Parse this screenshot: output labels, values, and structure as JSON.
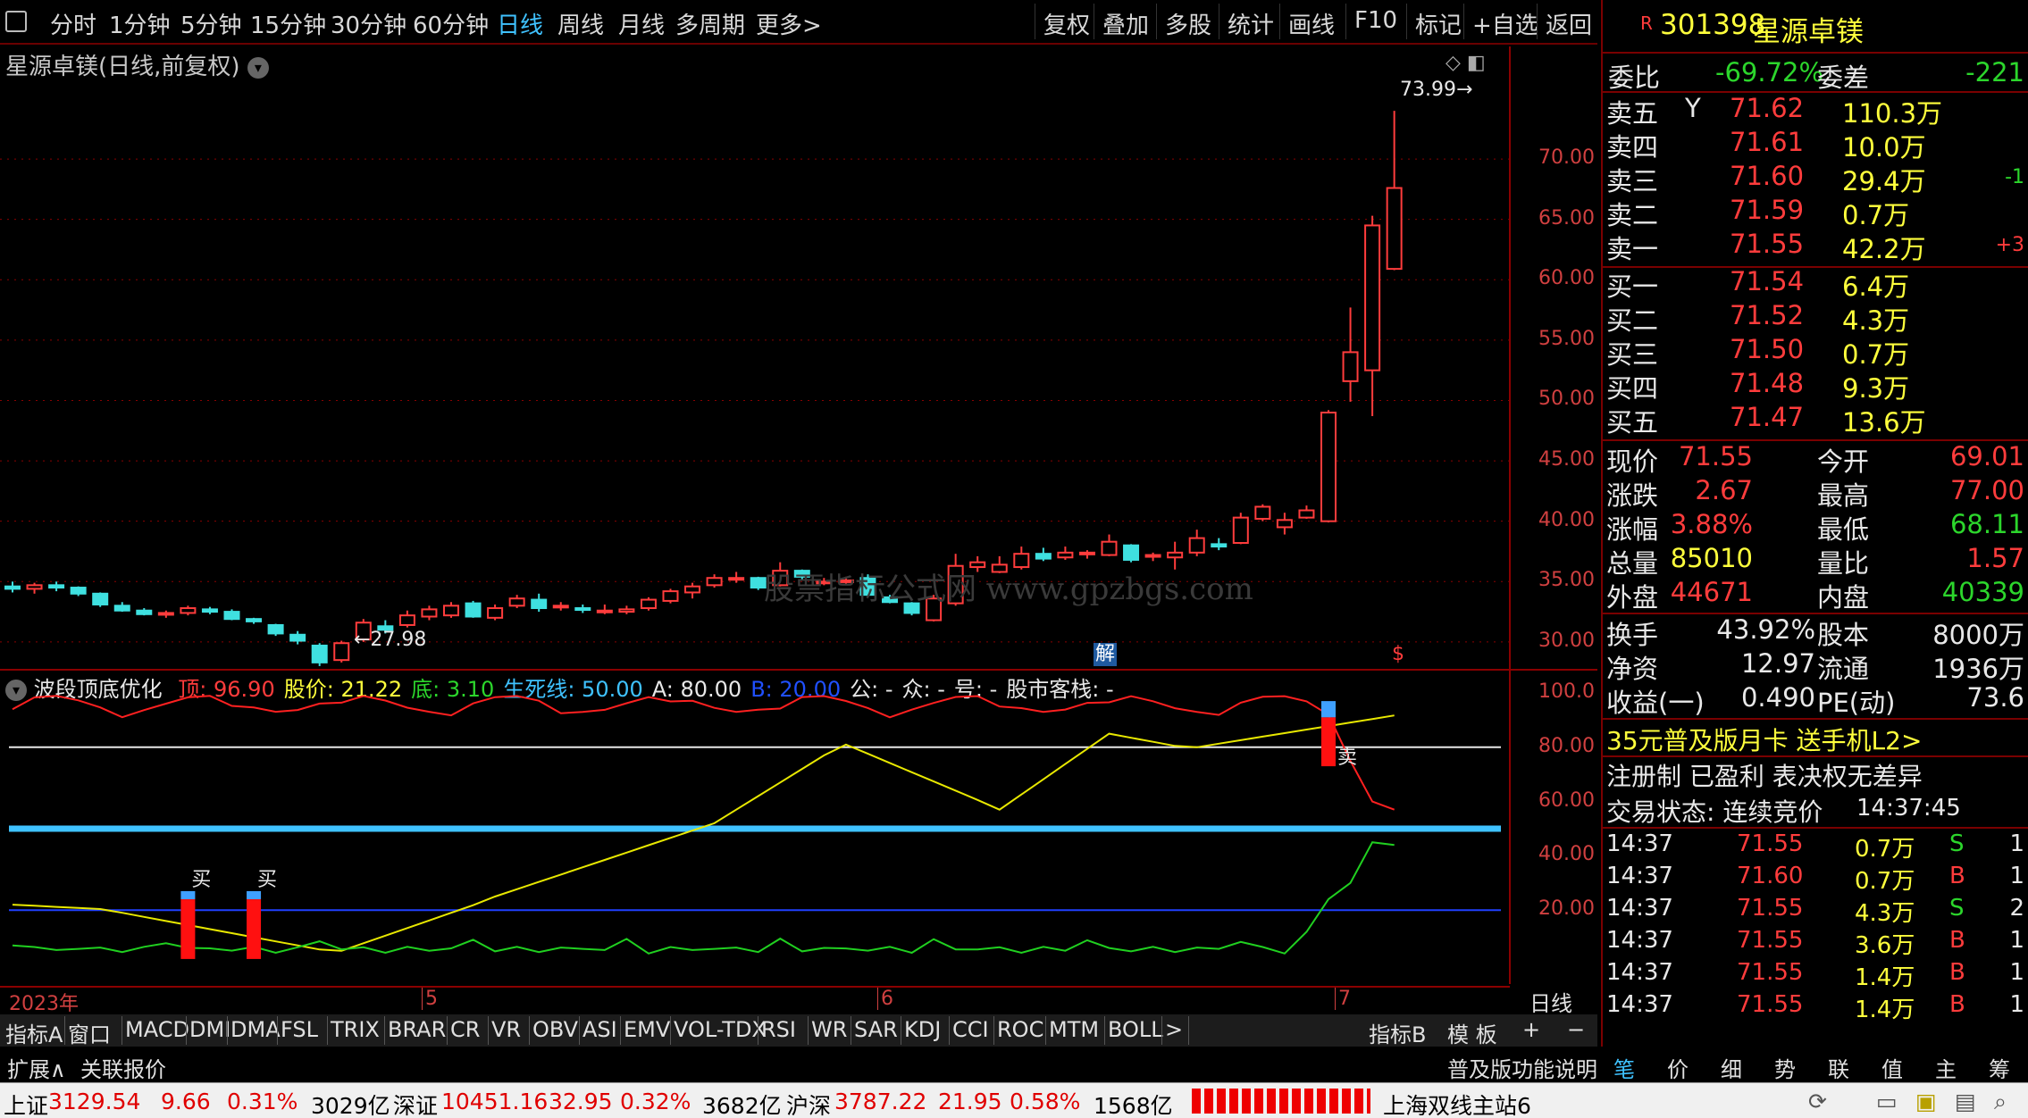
{
  "colors": {
    "up": "#ff3c3c",
    "down": "#3fe0e0",
    "bg": "#000000",
    "grid": "#8b0000",
    "accent": "#3fc2ff",
    "yellow": "#ffff3c",
    "green": "#2cd62c"
  },
  "toolbar": {
    "periods": [
      "分时",
      "1分钟",
      "5分钟",
      "15分钟",
      "30分钟",
      "60分钟",
      "日线",
      "周线",
      "月线",
      "多周期",
      "更多>"
    ],
    "active": "日线",
    "tools": [
      "复权",
      "叠加",
      "多股",
      "统计",
      "画线",
      "F10",
      "标记",
      "+自选",
      "返回"
    ]
  },
  "chart": {
    "title": "星源卓镁(日线,前复权)",
    "high_label": "73.99",
    "low_label": "←27.98",
    "y_ticks": [
      "70.00",
      "65.00",
      "60.00",
      "55.00",
      "50.00",
      "45.00",
      "40.00",
      "35.00",
      "30.00"
    ],
    "watermark": "股票指标公式网 www.gpzbgs.com",
    "marker_jie": "解",
    "marker_s": "$",
    "x_labels": [
      "2023年",
      "5",
      "6",
      "7"
    ],
    "period_label": "日线"
  },
  "chart_data": {
    "type": "candlestick",
    "y_range": [
      27,
      76
    ],
    "candles": [
      [
        34.6,
        35.0,
        34.1,
        34.4
      ],
      [
        34.4,
        34.9,
        34.0,
        34.7
      ],
      [
        34.7,
        35.0,
        34.2,
        34.5
      ],
      [
        34.5,
        34.6,
        33.8,
        34.0
      ],
      [
        34.0,
        34.1,
        32.9,
        33.1
      ],
      [
        33.0,
        33.3,
        32.5,
        32.6
      ],
      [
        32.6,
        32.8,
        32.2,
        32.3
      ],
      [
        32.3,
        32.6,
        32.0,
        32.4
      ],
      [
        32.4,
        33.0,
        32.2,
        32.8
      ],
      [
        32.7,
        32.9,
        32.3,
        32.5
      ],
      [
        32.5,
        32.7,
        31.8,
        31.9
      ],
      [
        31.9,
        32.0,
        31.5,
        31.7
      ],
      [
        31.4,
        31.5,
        30.5,
        30.7
      ],
      [
        30.6,
        30.9,
        29.8,
        30.1
      ],
      [
        29.7,
        29.9,
        28.0,
        28.3
      ],
      [
        28.5,
        30.1,
        28.3,
        29.9
      ],
      [
        30.2,
        31.9,
        30.0,
        31.6
      ],
      [
        31.3,
        31.8,
        30.7,
        31.0
      ],
      [
        31.4,
        32.6,
        31.2,
        32.2
      ],
      [
        32.1,
        33.0,
        31.8,
        32.7
      ],
      [
        32.2,
        33.3,
        32.0,
        33.0
      ],
      [
        33.2,
        33.4,
        32.0,
        32.1
      ],
      [
        32.0,
        33.1,
        31.8,
        32.8
      ],
      [
        33.0,
        33.9,
        32.8,
        33.6
      ],
      [
        33.5,
        34.0,
        32.5,
        32.8
      ],
      [
        32.9,
        33.3,
        32.6,
        33.0
      ],
      [
        32.8,
        33.1,
        32.4,
        32.7
      ],
      [
        32.6,
        33.1,
        32.3,
        32.6
      ],
      [
        32.5,
        33.0,
        32.3,
        32.7
      ],
      [
        32.8,
        33.7,
        32.6,
        33.5
      ],
      [
        33.4,
        34.4,
        33.2,
        34.2
      ],
      [
        34.1,
        34.9,
        33.6,
        34.6
      ],
      [
        34.7,
        35.6,
        34.5,
        35.3
      ],
      [
        35.3,
        35.8,
        34.9,
        35.3
      ],
      [
        35.3,
        35.4,
        34.3,
        34.5
      ],
      [
        34.7,
        36.6,
        34.6,
        35.9
      ],
      [
        35.9,
        36.0,
        35.1,
        35.4
      ],
      [
        35.0,
        35.3,
        34.7,
        35.0
      ],
      [
        35.1,
        35.4,
        34.8,
        35.1
      ],
      [
        35.3,
        35.6,
        33.8,
        33.9
      ],
      [
        33.7,
        33.9,
        33.2,
        33.3
      ],
      [
        33.2,
        33.3,
        32.2,
        32.4
      ],
      [
        31.8,
        33.9,
        31.7,
        33.6
      ],
      [
        33.2,
        37.3,
        33.0,
        36.3
      ],
      [
        36.2,
        37.1,
        35.8,
        36.6
      ],
      [
        35.8,
        37.1,
        35.7,
        36.4
      ],
      [
        36.2,
        37.9,
        36.0,
        37.3
      ],
      [
        37.3,
        37.8,
        36.7,
        36.9
      ],
      [
        37.0,
        37.9,
        36.8,
        37.4
      ],
      [
        37.4,
        37.6,
        36.9,
        37.4
      ],
      [
        37.2,
        38.9,
        37.1,
        38.3
      ],
      [
        38.0,
        38.1,
        36.6,
        36.8
      ],
      [
        37.1,
        37.4,
        36.7,
        37.2
      ],
      [
        37.0,
        38.3,
        36.0,
        37.4
      ],
      [
        37.4,
        39.3,
        37.1,
        38.6
      ],
      [
        38.1,
        38.6,
        37.6,
        37.9
      ],
      [
        38.2,
        40.7,
        38.1,
        40.3
      ],
      [
        40.2,
        41.4,
        40.0,
        41.2
      ],
      [
        39.5,
        40.7,
        38.9,
        40.1
      ],
      [
        40.3,
        41.3,
        40.2,
        40.9
      ],
      [
        40.0,
        49.2,
        39.9,
        49.0
      ],
      [
        51.6,
        57.7,
        49.9,
        54.0
      ],
      [
        52.5,
        65.3,
        48.7,
        64.5
      ],
      [
        60.9,
        73.99,
        60.8,
        67.6
      ]
    ]
  },
  "indicator": {
    "name": "波段顶底优化",
    "fields": [
      {
        "label": "顶:",
        "value": "96.90",
        "color": "#ff3c3c"
      },
      {
        "label": "股价:",
        "value": "21.22",
        "color": "#ffff3c"
      },
      {
        "label": "底:",
        "value": "3.10",
        "color": "#2cd62c"
      },
      {
        "label": "生死线:",
        "value": "50.00",
        "color": "#3fc2ff"
      },
      {
        "label": "A:",
        "value": "80.00",
        "color": "#e8e8e8"
      },
      {
        "label": "B:",
        "value": "20.00",
        "color": "#2050ff"
      },
      {
        "label": "公:",
        "value": "-",
        "color": "#e8e8e8"
      },
      {
        "label": "众:",
        "value": "-",
        "color": "#e8e8e8"
      },
      {
        "label": "号:",
        "value": "-",
        "color": "#e8e8e8"
      },
      {
        "label": "股市客栈:",
        "value": "-",
        "color": "#e8e8e8"
      }
    ],
    "y_ticks": [
      "100.0",
      "80.00",
      "60.00",
      "40.00",
      "20.00"
    ],
    "buy_label": "买",
    "sell_label": "卖"
  },
  "bottom_tabs": [
    "指标A",
    "窗口",
    "MACD",
    "DMI",
    "DMA",
    "FSL",
    "TRIX",
    "BRAR",
    "CR",
    "VR",
    "OBV",
    "ASI",
    "EMV",
    "VOL-TDX",
    "RSI",
    "WR",
    "SAR",
    "KDJ",
    "CCI",
    "ROC",
    "MTM",
    "BOLL",
    ">",
    "指标B",
    "模 板",
    "+",
    "−"
  ],
  "toolbar2": {
    "expand": "扩展∧",
    "related": "关联报价",
    "func": "普及版功能说明"
  },
  "right_tabs": [
    "笔",
    "价",
    "细",
    "势",
    "联",
    "值",
    "主",
    "筹"
  ],
  "quote": {
    "r_badge": "R",
    "code": "301398",
    "name": "星源卓镁",
    "weibi": {
      "label": "委比",
      "value": "-69.72%"
    },
    "weicha": {
      "label": "委差",
      "value": "-221"
    },
    "asks": [
      {
        "label": "卖五",
        "flag": "Y",
        "price": "71.62",
        "vol": "110.3万",
        "chg": ""
      },
      {
        "label": "卖四",
        "flag": "",
        "price": "71.61",
        "vol": "10.0万",
        "chg": ""
      },
      {
        "label": "卖三",
        "flag": "",
        "price": "71.60",
        "vol": "29.4万",
        "chg": "-1"
      },
      {
        "label": "卖二",
        "flag": "",
        "price": "71.59",
        "vol": "0.7万",
        "chg": ""
      },
      {
        "label": "卖一",
        "flag": "",
        "price": "71.55",
        "vol": "42.2万",
        "chg": "+3"
      }
    ],
    "bids": [
      {
        "label": "买一",
        "price": "71.54",
        "vol": "6.4万"
      },
      {
        "label": "买二",
        "price": "71.52",
        "vol": "4.3万"
      },
      {
        "label": "买三",
        "price": "71.50",
        "vol": "0.7万"
      },
      {
        "label": "买四",
        "price": "71.48",
        "vol": "9.3万"
      },
      {
        "label": "买五",
        "price": "71.47",
        "vol": "13.6万"
      }
    ],
    "stats": [
      [
        {
          "l": "现价",
          "v": "71.55",
          "c": "#ff3c3c"
        },
        {
          "l": "今开",
          "v": "69.01",
          "c": "#ff3c3c"
        }
      ],
      [
        {
          "l": "涨跌",
          "v": "2.67",
          "c": "#ff3c3c"
        },
        {
          "l": "最高",
          "v": "77.00",
          "c": "#ff3c3c"
        }
      ],
      [
        {
          "l": "涨幅",
          "v": "3.88%",
          "c": "#ff3c3c"
        },
        {
          "l": "最低",
          "v": "68.11",
          "c": "#2cd62c"
        }
      ],
      [
        {
          "l": "总量",
          "v": "85010",
          "c": "#ffff3c"
        },
        {
          "l": "量比",
          "v": "1.57",
          "c": "#ff3c3c"
        }
      ],
      [
        {
          "l": "外盘",
          "v": "44671",
          "c": "#ff3c3c"
        },
        {
          "l": "内盘",
          "v": "40339",
          "c": "#2cd62c"
        }
      ]
    ],
    "stats2": [
      [
        {
          "l": "换手",
          "v": "43.92%"
        },
        {
          "l": "股本",
          "v": "8000万"
        }
      ],
      [
        {
          "l": "净资",
          "v": "12.97"
        },
        {
          "l": "流通",
          "v": "1936万"
        }
      ],
      [
        {
          "l": "收益(一)",
          "v": "0.490"
        },
        {
          "l": "PE(动)",
          "v": "73.6"
        }
      ]
    ],
    "promo": "35元普及版月卡 送手机L2>",
    "notice": "注册制 已盈利 表决权无差异",
    "trade_status_label": "交易状态: 连续竞价",
    "trade_time": "14:37:45",
    "ticks": [
      {
        "t": "14:37",
        "p": "71.55",
        "v": "0.7万",
        "bs": "S",
        "n": "1"
      },
      {
        "t": "14:37",
        "p": "71.60",
        "v": "0.7万",
        "bs": "B",
        "n": "1"
      },
      {
        "t": "14:37",
        "p": "71.55",
        "v": "4.3万",
        "bs": "S",
        "n": "2"
      },
      {
        "t": "14:37",
        "p": "71.55",
        "v": "3.6万",
        "bs": "B",
        "n": "1"
      },
      {
        "t": "14:37",
        "p": "71.55",
        "v": "1.4万",
        "bs": "B",
        "n": "1"
      },
      {
        "t": "14:37",
        "p": "71.55",
        "v": "1.4万",
        "bs": "B",
        "n": "1"
      }
    ]
  },
  "status": {
    "sh": {
      "name": "上证",
      "val": "3129.54",
      "chg": "9.66",
      "pct": "0.31%",
      "amt": "3029亿"
    },
    "sz": {
      "name": "深证",
      "val": "10451.16",
      "chg": "32.95",
      "pct": "0.32%",
      "amt": "3682亿"
    },
    "hs": {
      "name": "沪深",
      "val": "3787.22",
      "chg": "21.95",
      "pct": "0.58%",
      "amt": "1568亿"
    },
    "server": "上海双线主站6"
  }
}
